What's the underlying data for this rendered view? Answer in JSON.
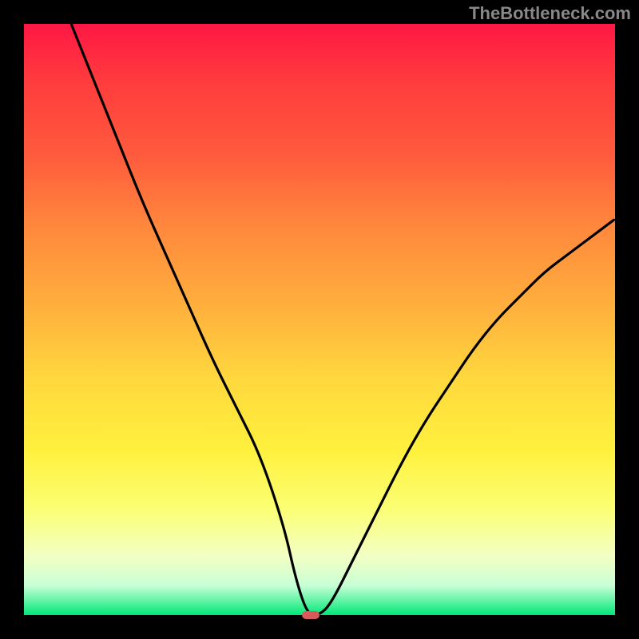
{
  "watermark": "TheBottleneck.com",
  "chart_data": {
    "type": "line",
    "title": "",
    "xlabel": "",
    "ylabel": "",
    "xlim": [
      0,
      100
    ],
    "ylim": [
      0,
      100
    ],
    "background_gradient": {
      "top_color": "#ff1744",
      "mid_color": "#ffd83d",
      "bottom_color": "#00e878"
    },
    "series": [
      {
        "name": "bottleneck-curve",
        "color": "#000000",
        "x": [
          8,
          12,
          16,
          20,
          24,
          28,
          32,
          36,
          40,
          44,
          46,
          48,
          50,
          52,
          56,
          60,
          64,
          68,
          72,
          76,
          80,
          84,
          88,
          92,
          96,
          100
        ],
        "y": [
          100,
          90,
          80,
          70,
          61,
          52,
          43,
          35,
          27,
          15,
          6,
          0,
          0,
          2,
          10,
          18,
          26,
          33,
          39,
          45,
          50,
          54,
          58,
          61,
          64,
          67
        ]
      }
    ],
    "marker": {
      "name": "optimal-point",
      "x": 48.5,
      "y": 0,
      "color": "#d85a5a"
    }
  }
}
